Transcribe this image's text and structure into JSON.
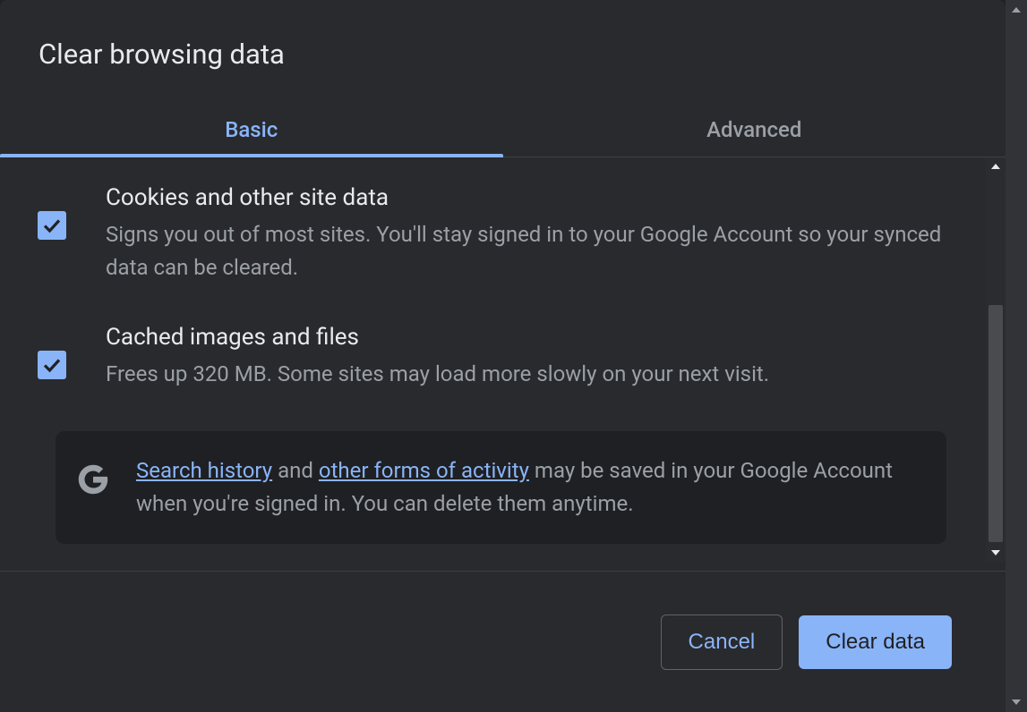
{
  "dialog": {
    "title": "Clear browsing data"
  },
  "tabs": {
    "basic": "Basic",
    "advanced": "Advanced"
  },
  "options": {
    "cookies": {
      "title": "Cookies and other site data",
      "desc": "Signs you out of most sites. You'll stay signed in to your Google Account so your synced data can be cleared."
    },
    "cache": {
      "title": "Cached images and files",
      "desc": "Frees up 320 MB. Some sites may load more slowly on your next visit."
    }
  },
  "info": {
    "link1": "Search history",
    "mid1": " and ",
    "link2": "other forms of activity",
    "rest": " may be saved in your Google Account when you're signed in. You can delete them anytime."
  },
  "footer": {
    "cancel": "Cancel",
    "clear": "Clear data"
  }
}
